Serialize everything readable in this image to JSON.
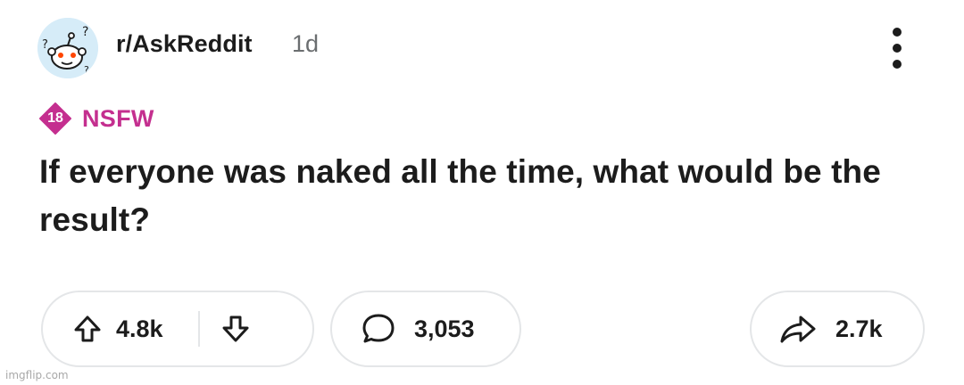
{
  "post": {
    "subreddit": "r/AskReddit",
    "age": "1d",
    "nsfw": {
      "badge_number": "18",
      "label": "NSFW",
      "color": "#c42f8f"
    },
    "title": "If everyone was naked all the time, what would be the result?"
  },
  "actions": {
    "upvote_icon": "arrow-up-icon",
    "votes": "4.8k",
    "downvote_icon": "arrow-down-icon",
    "comment_icon": "comment-bubble-icon",
    "comments": "3,053",
    "share_icon": "share-arrow-icon",
    "shares": "2.7k"
  },
  "watermark": "imgflip.com",
  "colors": {
    "text": "#1c1c1c",
    "muted": "#6b6e70",
    "border": "#e4e6e8",
    "avatar_bg": "#d6ecf8"
  }
}
